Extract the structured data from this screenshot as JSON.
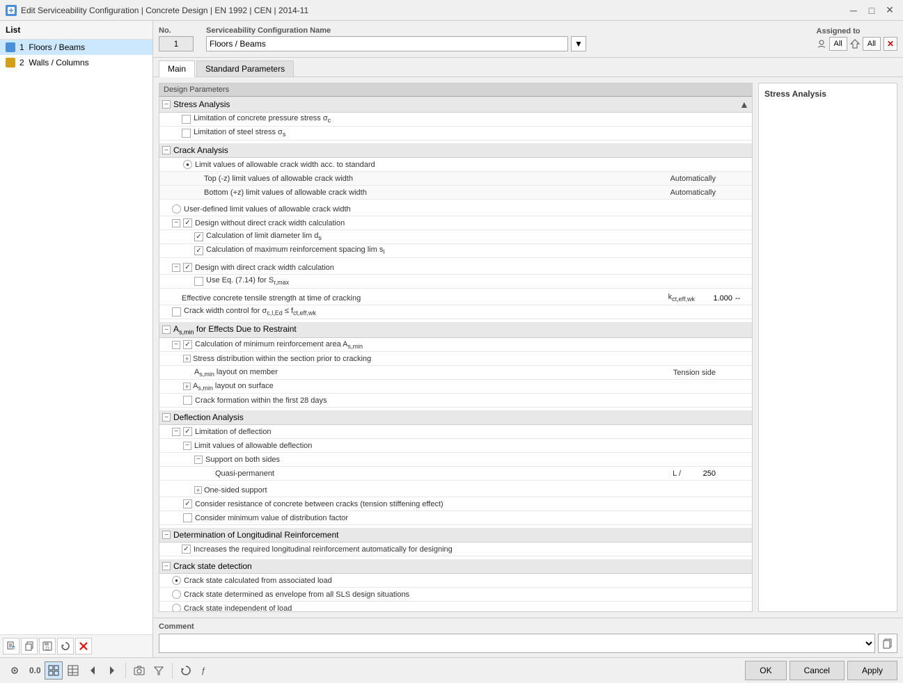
{
  "titleBar": {
    "title": "Edit Serviceability Configuration | Concrete Design | EN 1992 | CEN | 2014-11",
    "icon": "edit-icon"
  },
  "leftPanel": {
    "header": "List",
    "items": [
      {
        "id": 1,
        "label": "Floors / Beams",
        "iconColor": "blue",
        "selected": true
      },
      {
        "id": 2,
        "label": "Walls / Columns",
        "iconColor": "gold",
        "selected": false
      }
    ],
    "toolbar": {
      "buttons": [
        "new",
        "copy",
        "save",
        "reload",
        "delete"
      ]
    }
  },
  "topArea": {
    "noLabel": "No.",
    "noValue": "1",
    "nameLabel": "Serviceability Configuration Name",
    "nameValue": "Floors / Beams",
    "assignedLabel": "Assigned to",
    "assignedAll1": "All",
    "assignedAll2": "All"
  },
  "tabs": [
    {
      "id": "main",
      "label": "Main",
      "active": true
    },
    {
      "id": "standard",
      "label": "Standard Parameters",
      "active": false
    }
  ],
  "designParams": {
    "header": "Design Parameters",
    "sections": [
      {
        "id": "stress-analysis",
        "label": "Stress Analysis",
        "expanded": true,
        "items": [
          {
            "type": "checkbox",
            "checked": false,
            "label": "Limitation of concrete pressure stress σc",
            "indent": 1
          },
          {
            "type": "checkbox",
            "checked": false,
            "label": "Limitation of steel stress σs",
            "indent": 1
          }
        ]
      },
      {
        "id": "crack-analysis",
        "label": "Crack Analysis",
        "expanded": true,
        "items": [
          {
            "type": "radio",
            "checked": true,
            "label": "Limit values of allowable crack width acc. to standard",
            "indent": 1
          },
          {
            "type": "text",
            "label": "Top (-z) limit values of allowable crack width",
            "value": "Automatically",
            "indent": 3
          },
          {
            "type": "text",
            "label": "Bottom (+z) limit values of allowable crack width",
            "value": "Automatically",
            "indent": 3
          },
          {
            "type": "radio",
            "checked": false,
            "label": "User-defined limit values of allowable crack width",
            "indent": 1
          },
          {
            "type": "checkbox",
            "checked": true,
            "label": "Design without direct crack width calculation",
            "indent": 1,
            "children": [
              {
                "type": "checkbox",
                "checked": true,
                "label": "Calculation of limit diameter lim ds",
                "indent": 2
              },
              {
                "type": "checkbox",
                "checked": true,
                "label": "Calculation of maximum reinforcement spacing lim sl",
                "indent": 2
              }
            ]
          },
          {
            "type": "checkbox",
            "checked": true,
            "label": "Design with direct crack width calculation",
            "indent": 1,
            "children": [
              {
                "type": "checkbox",
                "checked": false,
                "label": "Use Eq. (7.14) for Sr,max",
                "indent": 2
              }
            ]
          },
          {
            "type": "text",
            "label": "Effective concrete tensile strength at time of cracking",
            "symbol": "kct,eff,wk",
            "value": "1.000",
            "unit": "--",
            "indent": 1
          },
          {
            "type": "checkbox",
            "checked": false,
            "label": "Crack width control for σc,l,Ed ≤ fct,eff,wk",
            "indent": 1
          }
        ]
      },
      {
        "id": "asmin",
        "label": "As,min for Effects Due to Restraint",
        "expanded": true,
        "items": [
          {
            "type": "checkbox",
            "checked": true,
            "label": "Calculation of minimum reinforcement area As,min",
            "indent": 1
          },
          {
            "type": "expand",
            "label": "Stress distribution within the section prior to cracking",
            "indent": 2
          },
          {
            "type": "text",
            "label": "As,min layout on member",
            "value": "Tension side",
            "indent": 3
          },
          {
            "type": "expand",
            "label": "As,min layout on surface",
            "indent": 2
          },
          {
            "type": "checkbox",
            "checked": false,
            "label": "Crack formation within the first 28 days",
            "indent": 2
          }
        ]
      },
      {
        "id": "deflection",
        "label": "Deflection Analysis",
        "expanded": true,
        "items": [
          {
            "type": "checkbox",
            "checked": true,
            "label": "Limitation of deflection",
            "indent": 1
          },
          {
            "type": "expand",
            "label": "Limit values of allowable deflection",
            "indent": 2,
            "children": [
              {
                "type": "expand",
                "label": "Support on both sides",
                "indent": 3,
                "children": [
                  {
                    "type": "text",
                    "label": "Quasi-permanent",
                    "symbol": "L /",
                    "value": "250",
                    "indent": 5
                  }
                ]
              },
              {
                "type": "expand",
                "label": "One-sided support",
                "indent": 3
              }
            ]
          },
          {
            "type": "checkbox",
            "checked": true,
            "label": "Consider resistance of concrete between cracks (tension stiffening effect)",
            "indent": 2
          },
          {
            "type": "checkbox",
            "checked": false,
            "label": "Consider minimum value of distribution factor",
            "indent": 2
          }
        ]
      },
      {
        "id": "longitudinal",
        "label": "Determination of Longitudinal Reinforcement",
        "expanded": true,
        "items": [
          {
            "type": "checkbox",
            "checked": true,
            "label": "Increases the required longitudinal reinforcement automatically for designing",
            "indent": 1
          }
        ]
      },
      {
        "id": "crack-state",
        "label": "Crack state detection",
        "expanded": true,
        "items": [
          {
            "type": "radio",
            "checked": true,
            "label": "Crack state calculated from associated load",
            "indent": 1
          },
          {
            "type": "radio",
            "checked": false,
            "label": "Crack state determined as envelope from all SLS design situations",
            "indent": 1
          },
          {
            "type": "radio",
            "checked": false,
            "label": "Crack state independent of load",
            "indent": 1
          }
        ]
      }
    ]
  },
  "stressPanel": {
    "title": "Stress Analysis"
  },
  "comment": {
    "label": "Comment",
    "placeholder": "",
    "copyButton": "⧉"
  },
  "bottomToolbar": {
    "tools": [
      "view-icon",
      "number-icon",
      "grid-icon",
      "table-icon",
      "arrow-left-icon",
      "arrow-right-icon",
      "separator",
      "camera-icon",
      "filter-icon",
      "separator2",
      "refresh-icon",
      "formula-icon"
    ]
  },
  "actions": {
    "ok": "OK",
    "cancel": "Cancel",
    "apply": "Apply"
  }
}
